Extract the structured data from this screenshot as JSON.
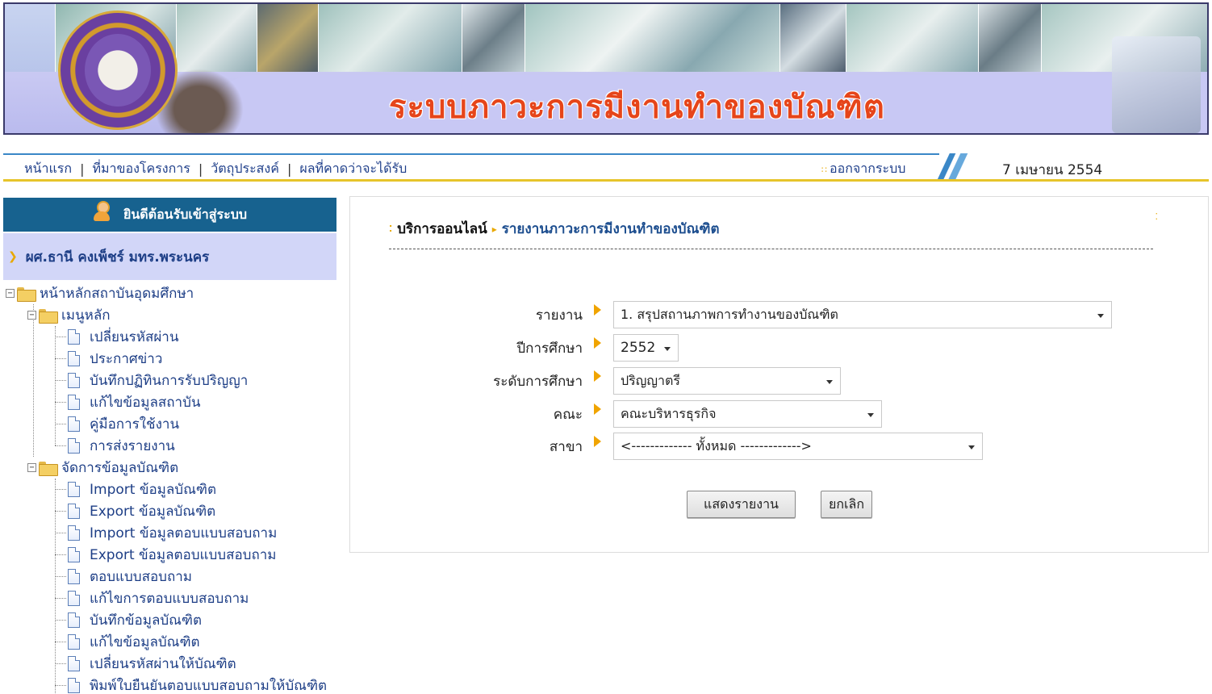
{
  "banner": {
    "title": "ระบบภาวะการมีงานทำของบัณฑิต"
  },
  "nav": {
    "links": [
      "หน้าแรก",
      "ที่มาของโครงการ",
      "วัตถุประสงค์",
      "ผลที่คาดว่าจะได้รับ"
    ],
    "logout": "ออกจากระบบ",
    "date": "7 เมษายน 2554"
  },
  "sidebar": {
    "welcome": "ยินดีต้อนรับเข้าสู่ระบบ",
    "user": "ผศ.ธานี คงเพ็ชร์ มทร.พระนคร",
    "root": "หน้าหลักสถาบันอุดมศึกษา",
    "groups": [
      {
        "label": "เมนูหลัก",
        "items": [
          "เปลี่ยนรหัสผ่าน",
          "ประกาศข่าว",
          "บันทึกปฏิทินการรับปริญญา",
          "แก้ไขข้อมูลสถาบัน",
          "คู่มือการใช้งาน",
          "การส่งรายงาน"
        ]
      },
      {
        "label": "จัดการข้อมูลบัณฑิต",
        "items": [
          "Import ข้อมูลบัณฑิต",
          "Export ข้อมูลบัณฑิต",
          "Import ข้อมูลตอบแบบสอบถาม",
          "Export ข้อมูลตอบแบบสอบถาม",
          "ตอบแบบสอบถาม",
          "แก้ไขการตอบแบบสอบถาม",
          "บันทึกข้อมูลบัณฑิต",
          "แก้ไขข้อมูลบัณฑิต",
          "เปลี่ยนรหัสผ่านให้บัณฑิต",
          "พิมพ์ใบยืนยันตอบแบบสอบถามให้บัณฑิต"
        ]
      }
    ]
  },
  "main": {
    "breadcrumb": [
      "บริการออนไลน์",
      "รายงานภาวะการมีงานทำของบัณฑิต"
    ],
    "form": [
      {
        "label": "รายงาน",
        "value": "1. สรุปสถานภาพการทำงานของบัณฑิต"
      },
      {
        "label": "ปีการศึกษา",
        "value": "2552"
      },
      {
        "label": "ระดับการศึกษา",
        "value": "ปริญญาตรี"
      },
      {
        "label": "คณะ",
        "value": "คณะบริหารธุรกิจ"
      },
      {
        "label": "สาขา",
        "value": "<------------- ทั้งหมด ------------->"
      }
    ],
    "buttons": {
      "show": "แสดงรายงาน",
      "cancel": "ยกเลิก"
    }
  },
  "colors": {
    "nav_blue": "#3a87c7",
    "nav_gold": "#e7c42a",
    "welcome_bg": "#17628f",
    "user_bg": "#d2d6f8",
    "link": "#1d3e86",
    "accent_arrow": "#f0a400"
  }
}
